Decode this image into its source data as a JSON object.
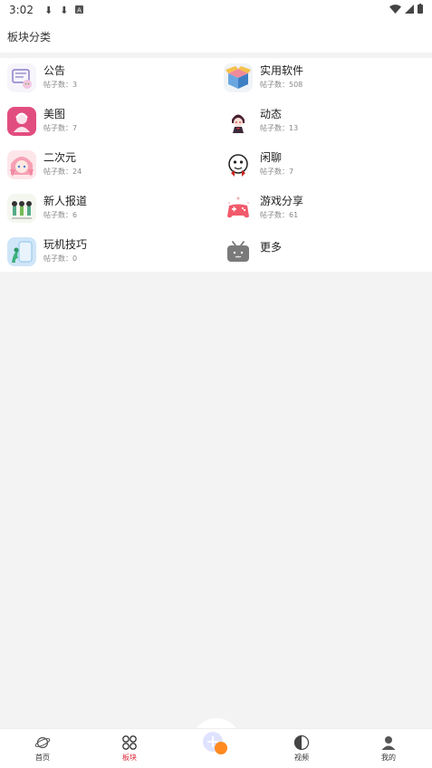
{
  "status": {
    "time": "3:02"
  },
  "header": {
    "title": "板块分类"
  },
  "boards": [
    {
      "name": "公告",
      "count": "帖子数：3"
    },
    {
      "name": "实用软件",
      "count": "帖子数：508"
    },
    {
      "name": "美图",
      "count": "帖子数：7"
    },
    {
      "name": "动态",
      "count": "帖子数：13"
    },
    {
      "name": "二次元",
      "count": "帖子数：24"
    },
    {
      "name": "闲聊",
      "count": "帖子数：7"
    },
    {
      "name": "新人报道",
      "count": "帖子数：6"
    },
    {
      "name": "游戏分享",
      "count": "帖子数：61"
    },
    {
      "name": "玩机技巧",
      "count": "帖子数：0"
    },
    {
      "name": "更多"
    }
  ],
  "nav": {
    "home": "首页",
    "boards": "板块",
    "video": "视频",
    "mine": "我的"
  },
  "colors": {
    "active": "#e0283a",
    "fab": "#ff8a1f"
  }
}
